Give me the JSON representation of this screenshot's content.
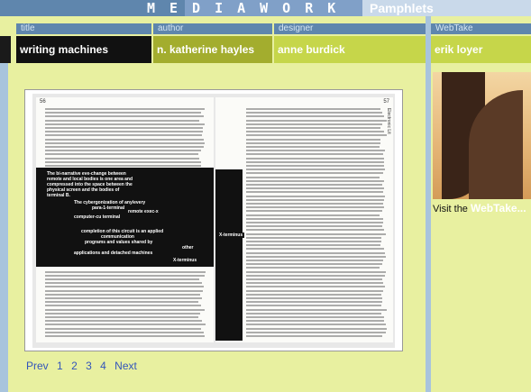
{
  "header": {
    "brand": "MEDIAWORK",
    "section": "Pamphlets"
  },
  "meta": {
    "title_label": "title",
    "title_value": "writing machines",
    "author_label": "author",
    "author_value": "n. katherine hayles",
    "designer_label": "designer",
    "designer_value": "anne burdick",
    "webtake_label": "WebTake",
    "webtake_value": "erik loyer"
  },
  "spread": {
    "left_page_number": "56",
    "right_page_number": "57",
    "right_running_head": "Electronic Lit",
    "masked_phrases": [
      "The bi-narrative eve-change between",
      "remote and local bodies is one area and",
      "compressed into the space between the",
      "physical screen and the bodies of",
      "terminal B.",
      "The cybergonization of any/every",
      "para-1-terminal",
      "remote exec-x",
      "computer-cu terminal",
      "completion of this circuit is an applied",
      "communication",
      "programs and values shared by",
      "other",
      "applications and detached machines",
      "X-terminus",
      "X-terminus"
    ]
  },
  "pager": {
    "prev": "Prev",
    "pages": [
      "1",
      "2",
      "3",
      "4"
    ],
    "next": "Next"
  },
  "webtake": {
    "visit_prefix": "Visit the",
    "visit_link": "WebTake..."
  },
  "colors": {
    "page_bg": "#e8f0a0",
    "header_blue": "#5f86ad",
    "value_green": "#c6d64a",
    "link_blue": "#3355bb"
  }
}
